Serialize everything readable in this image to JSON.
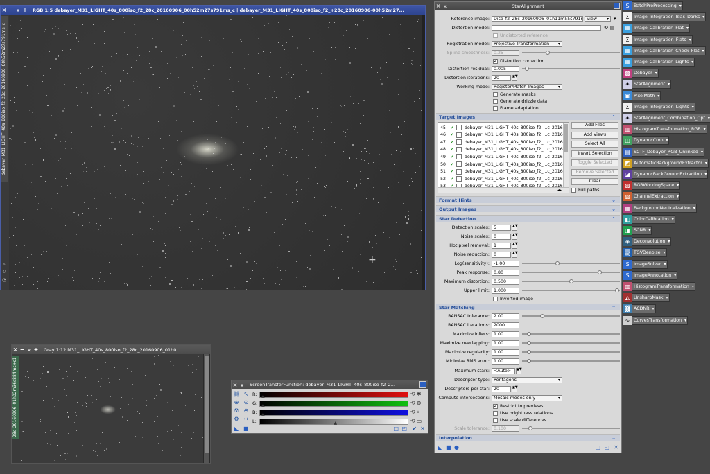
{
  "main_window": {
    "title": "RGB 1:5 debayer_M31_LIGHT_40s_800iso_f2_28c_20160906_00h52m27s791ms_c | debayer_M31_LIGHT_40s_800iso_f2_+28c_20160906-00h52m27...",
    "side_tab": "debayer_M31_LIGHT_40s_800iso_f2_28c_20160906_00h52m27s791ms_c"
  },
  "gray_window": {
    "title": "Gray 1:12 M31_LIGHT_40s_800iso_f2_28c_20160906_01h0...",
    "side_tab": "28c_20160906_01h02m36s884ms+s1"
  },
  "stf_window": {
    "title": "ScreenTransferFunction: debayer_M31_LIGHT_40s_800iso_f2_2...",
    "channels": [
      "R:",
      "G:",
      "B:",
      "L:"
    ],
    "channel_colors": [
      "#e01010",
      "#10c010",
      "#1010e0",
      "#ffffff"
    ]
  },
  "star_alignment": {
    "title": "StarAlignment",
    "reference_image_label": "Reference image:",
    "reference_image_value": "Diso_f2_28c_20160906_01h11m55s791ms",
    "view_label": "View",
    "distortion_model_label": "Distortion model:",
    "distortion_model_value": "",
    "undistorted_reference": "Undistorted reference",
    "registration_model_label": "Registration model:",
    "registration_model_value": "Projective Transformation",
    "spline_smoothness_label": "Spline smoothness:",
    "spline_smoothness_value": "0.25",
    "distortion_correction": "Distortion correction",
    "distortion_residual_label": "Distortion residual:",
    "distortion_residual_value": "0.005",
    "distortion_iterations_label": "Distortion iterations:",
    "distortion_iterations_value": "20",
    "working_mode_label": "Working mode:",
    "working_mode_value": "Register/Match Images",
    "generate_masks": "Generate masks",
    "generate_drizzle": "Generate drizzle data",
    "frame_adaptation": "Frame adaptation",
    "target_images_title": "Target Images",
    "target_rows": [
      {
        "n": "45",
        "name": "debayer_M31_LIGHT_40s_800iso_f2_...c_2016"
      },
      {
        "n": "46",
        "name": "debayer_M31_LIGHT_40s_800iso_f2_...c_2016"
      },
      {
        "n": "47",
        "name": "debayer_M31_LIGHT_40s_800iso_f2_...c_2016"
      },
      {
        "n": "48",
        "name": "debayer_M31_LIGHT_40s_800iso_f2_...c_2016"
      },
      {
        "n": "49",
        "name": "debayer_M31_LIGHT_40s_800iso_f2_...c_2016"
      },
      {
        "n": "50",
        "name": "debayer_M31_LIGHT_40s_800iso_f2_...c_2016"
      },
      {
        "n": "51",
        "name": "debayer_M31_LIGHT_40s_800iso_f2_...c_2016"
      },
      {
        "n": "52",
        "name": "debayer_M31_LIGHT_40s_800iso_f2_...c_2016"
      },
      {
        "n": "53",
        "name": "debayer_M31_LIGHT_40s_800iso_f2_...c_2016"
      }
    ],
    "buttons": {
      "add_files": "Add Files",
      "add_views": "Add Views",
      "select_all": "Select All",
      "invert_selection": "Invert Selection",
      "toggle_selected": "Toggle Selected",
      "remove_selected": "Remove Selected",
      "clear": "Clear"
    },
    "full_paths": "Full paths",
    "format_hints_title": "Format Hints",
    "output_images_title": "Output Images",
    "star_detection_title": "Star Detection",
    "detection_scales_label": "Detection scales:",
    "detection_scales_value": "5",
    "noise_scales_label": "Noise scales:",
    "noise_scales_value": "0",
    "hot_pixel_label": "Hot pixel removal:",
    "hot_pixel_value": "1",
    "noise_reduction_label": "Noise reduction:",
    "noise_reduction_value": "0",
    "log_sensitivity_label": "Log(sensitivity):",
    "log_sensitivity_value": "-1.00",
    "peak_response_label": "Peak response:",
    "peak_response_value": "0.80",
    "max_distortion_label": "Maximum distortion:",
    "max_distortion_value": "0.500",
    "upper_limit_label": "Upper limit:",
    "upper_limit_value": "1.000",
    "inverted_image": "Inverted image",
    "star_matching_title": "Star Matching",
    "ransac_tol_label": "RANSAC tolerance:",
    "ransac_tol_value": "2.00",
    "ransac_iter_label": "RANSAC iterations:",
    "ransac_iter_value": "2000",
    "max_inliers_label": "Maximize inliers:",
    "max_inliers_value": "1.00",
    "max_overlapping_label": "Maximize overlapping:",
    "max_overlapping_value": "1.00",
    "max_regularity_label": "Maximize regularity:",
    "max_regularity_value": "1.00",
    "min_rms_label": "Minimize RMS error:",
    "min_rms_value": "1.00",
    "max_stars_label": "Maximum stars:",
    "max_stars_value": "<Auto>",
    "descriptor_type_label": "Descriptor type:",
    "descriptor_type_value": "Pentagons",
    "descriptors_per_star_label": "Descriptors per star:",
    "descriptors_per_star_value": "20",
    "compute_intersections_label": "Compute intersections:",
    "compute_intersections_value": "Mosaic modes only",
    "restrict_previews": "Restrict to previews",
    "use_brightness": "Use brightness relations",
    "use_scale": "Use scale differences",
    "scale_tolerance_label": "Scale tolerance:",
    "scale_tolerance_value": "0.100",
    "interpolation_title": "Interpolation"
  },
  "processes": [
    {
      "label": "BatchPreProcessing",
      "icon": "script-icon"
    },
    {
      "label": "Image_Integration_Bias_Darks",
      "icon": "sigma-icon"
    },
    {
      "label": "Image_Calibration_Flat",
      "icon": "calibration-icon"
    },
    {
      "label": "Image_Integration_Flats",
      "icon": "sigma-icon"
    },
    {
      "label": "Image_Calibration_Check_Flat",
      "icon": "calibration-icon"
    },
    {
      "label": "Image_Calibration_Lights",
      "icon": "calibration-icon"
    },
    {
      "label": "Debayer",
      "icon": "debayer-icon"
    },
    {
      "label": "StarAlignment",
      "icon": "star-alignment-icon"
    },
    {
      "label": "PixelMath",
      "icon": "pixelmath-icon"
    },
    {
      "label": "Image_Integration_Lights",
      "icon": "sigma-icon"
    },
    {
      "label": "StarAlignment_Combination_Opt",
      "icon": "star-alignment-icon"
    },
    {
      "label": "HistogramTransformation_RGB",
      "icon": "histogram-icon"
    },
    {
      "label": "DynamicCrop",
      "icon": "crop-icon"
    },
    {
      "label": "SCTF_Debayer_RGB_Unlinked",
      "icon": "stf-icon"
    },
    {
      "label": "AutomaticBackgroundExtractor",
      "icon": "abe-icon"
    },
    {
      "label": "DynamicBackGroundExtraction",
      "icon": "dbe-icon"
    },
    {
      "label": "RGBWorkingSpace",
      "icon": "rgb-icon"
    },
    {
      "label": "ChannelExtraction",
      "icon": "channel-icon"
    },
    {
      "label": "BackgroundNeutralization",
      "icon": "bgn-icon"
    },
    {
      "label": "ColorCalibration",
      "icon": "color-icon"
    },
    {
      "label": "SCNR",
      "icon": "scnr-icon"
    },
    {
      "label": "Deconvolution",
      "icon": "deconv-icon"
    },
    {
      "label": "TGVDenoise",
      "icon": "denoise-icon"
    },
    {
      "label": "ImageSolver",
      "icon": "script-icon"
    },
    {
      "label": "ImageAnnotation",
      "icon": "script-icon"
    },
    {
      "label": "HistogramTransformation",
      "icon": "histogram-icon"
    },
    {
      "label": "UnsharpMask",
      "icon": "unsharp-icon"
    },
    {
      "label": "ACDNR",
      "icon": "acdnr-icon"
    },
    {
      "label": "CurvesTransformation",
      "icon": "curves-icon"
    }
  ]
}
